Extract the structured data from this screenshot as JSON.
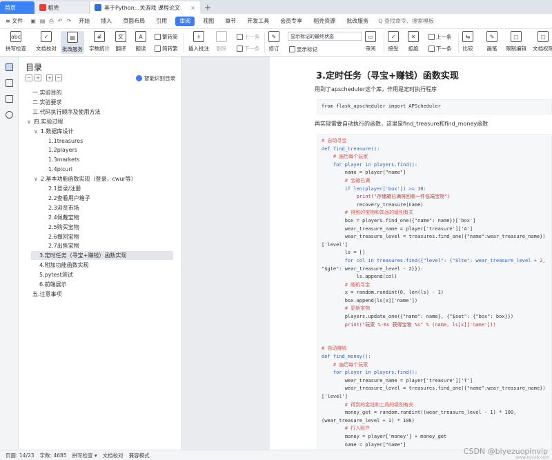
{
  "tabs": [
    {
      "label": "首页",
      "kind": "home"
    },
    {
      "label": "稻壳",
      "kind": "docer"
    },
    {
      "label": "基于Python...关游戏 课程论文",
      "kind": "doc",
      "close": "×"
    }
  ],
  "new_tab": "+",
  "menu": {
    "file": "≡ 文件",
    "items": [
      "开始",
      "插入",
      "页面布局",
      "引用",
      "审阅",
      "视图",
      "章节",
      "开发工具",
      "会员专享",
      "稻壳资源",
      "批改服务"
    ],
    "selected": "审阅",
    "search_placeholder": "Q 查找命令、搜索模板"
  },
  "ribbon": {
    "spell_check": "拼写检查",
    "doc_proof": "文档校对",
    "batch_service": "批改服务",
    "word_count": "字数统计",
    "translate": "翻译",
    "read_aloud": "朗读",
    "to_traditional": "繁转简",
    "to_simplified": "简转繁",
    "insert_comment": "插入批注",
    "delete": "删除",
    "prev": "上一条",
    "next": "下一条",
    "revise": "修订",
    "markup_select": "显示标记的最终状态",
    "show_markup": "显示标记",
    "review": "审阅",
    "accept": "接受",
    "reject": "拒绝",
    "prev2": "上一条",
    "next2": "下一条",
    "compare": "比较",
    "ink": "画笔",
    "restrict": "限制编辑",
    "doc_permission": "文档权限"
  },
  "toc": {
    "title": "目录",
    "smart": "智能识别目录",
    "items": [
      {
        "text": "一.实验目的",
        "level": 0
      },
      {
        "text": "二.实验要求",
        "level": 0
      },
      {
        "text": "三.代码执行顺序及使用方法",
        "level": 0
      },
      {
        "text": "四.实验过程",
        "level": 0,
        "caret": "∨"
      },
      {
        "text": "1.数据库设计",
        "level": 1,
        "caret": "∨"
      },
      {
        "text": "1.1treasures",
        "level": 2
      },
      {
        "text": "1.2players",
        "level": 2
      },
      {
        "text": "1.3markets",
        "level": 2
      },
      {
        "text": "1.4picurl",
        "level": 2
      },
      {
        "text": "2.基本功能函数实现（登录，cwur等）",
        "level": 1,
        "caret": "∨"
      },
      {
        "text": "2.1登录/注册",
        "level": 2
      },
      {
        "text": "2.2查看用户箱子",
        "level": 2
      },
      {
        "text": "2.3浏览市场",
        "level": 2
      },
      {
        "text": "2.4佩戴宝物",
        "level": 2
      },
      {
        "text": "2.5购买宝物",
        "level": 2
      },
      {
        "text": "2.6撤回宝物",
        "level": 2
      },
      {
        "text": "2.7出售宝物",
        "level": 2
      },
      {
        "text": "3.定时任务（寻宝+赚钱）函数实现",
        "level": 1,
        "current": true
      },
      {
        "text": "4.附加功能函数实现",
        "level": 1
      },
      {
        "text": "5.pytest测试",
        "level": 1
      },
      {
        "text": "6.前端展示",
        "level": 1
      },
      {
        "text": "五.注意事项",
        "level": 0
      }
    ]
  },
  "doc": {
    "heading": "3.定时任务（寻宝+赚钱）函数实现",
    "p1": "用到了apscheduler这个库，作用是定时执行程序",
    "code1": "from flask_apscheduler import APScheduler",
    "p2": "再实现需要自动执行的函数，这里是find_treasure和find_money函数",
    "code2": [
      "# 自动寻宝",
      "def find_treasure():",
      "    # 遍历每个玩家",
      "    for player in players.find():",
      "        name = player[\"name\"]",
      "        # 宝箱已满",
      "        if len(player['box']) >= 10:",
      "            print(\"存储箱已满将回收一件低端宝物\")",
      "            recovery_treasure(name)",
      "        # 得到的宝物和饰品的级别有关",
      "        box = players.find_one({\"name\": name})['box']",
      "        wear_treasure_name = player['treasure']['A']",
      "        wear_treasure_level = treasures.find_one({\"name\":wear_treasure_name})",
      "['level']",
      "        ls = []",
      "        for col in treasures.find({\"level\": {\"$lte\": wear_treasure_level + 2,",
      "\"$gte\": wear_treasure_level - 2}}):",
      "            ls.append(col)",
      "        # 随机寻宝",
      "        x = random.randint(0, len(ls) - 1)",
      "        box.append(ls[x]['name'])",
      "        # 更新宝物",
      "        players.update_one({\"name\": name}, {\"$set\": {\"box\": box}})",
      "        print(\"玩家 %-6s 获得宝物 %s\" % (name, ls[x]['name']))",
      "",
      "",
      "# 自动赚钱",
      "def find_money():",
      "    # 遍历每个玩家",
      "    for player in players.find():",
      "        wear_treasure_name = player['treasure']['T']",
      "        wear_treasure_level = treasures.find_one({\"name\":wear_treasure_name})",
      "['level']",
      "        # 得到的金钱和工具的级别有关",
      "        money_get = random.randint((wear_treasure_level - 1) * 100,",
      "(wear_treasure_level + 1) * 100)",
      "        # 打入账户",
      "        money = player['money'] + money_get",
      "        name = player[\"name\"]"
    ]
  },
  "status": {
    "page": "页面: 14/23",
    "words": "字数: 4685",
    "spell": "拼写检查 ▾",
    "proof": "文档校对",
    "compat": "兼容模式"
  },
  "watermark": "CSDN @biyezuopinvip",
  "watermark2": "www.xyxxb.com"
}
